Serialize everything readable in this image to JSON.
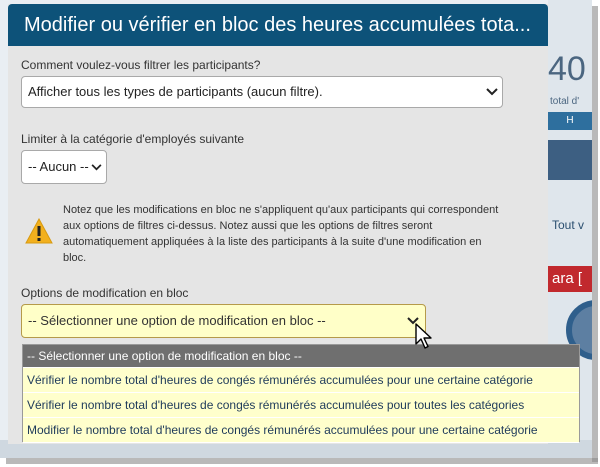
{
  "background": {
    "big_number": "40",
    "small_caption": "total d'",
    "button_label": "H",
    "tout_label": "Tout v",
    "ara_label": "ara ["
  },
  "modal": {
    "title": "Modifier ou vérifier en bloc des heures accumulées tota...",
    "filter_label": "Comment voulez-vous filtrer les participants?",
    "filter_value": "Afficher tous les types de participants (aucun filtre).",
    "category_label": "Limiter à la catégorie d'employés suivante",
    "category_value": "-- Aucun --",
    "note": "Notez que les modifications en bloc ne s'appliquent qu'aux participants qui correspondent aux options de filtres ci-dessus. Notez aussi que les options de filtres seront automatiquement appliquées à la liste des participants à la suite d'une modification en bloc.",
    "options_label": "Options de modification en bloc",
    "options_value": "-- Sélectionner une option de modification en bloc --",
    "options_items": [
      "-- Sélectionner une option de modification en bloc --",
      "Vérifier le nombre total d'heures de congés rémunérés accumulées pour une certaine catégorie",
      "Vérifier le nombre total d'heures de congés rémunérés accumulées pour toutes les catégories",
      "Modifier le nombre total d'heures de congés rémunérés accumulées pour une certaine catégorie"
    ]
  },
  "colors": {
    "title_bar": "#0d5279",
    "open_select_bg": "#ffffc8",
    "selected_option_bg": "#6f6f6f",
    "warning": "#f2b01e"
  },
  "icons": {
    "warning": "warning-icon",
    "chevron": "chevron-down-icon",
    "cursor": "mouse-pointer-icon"
  }
}
